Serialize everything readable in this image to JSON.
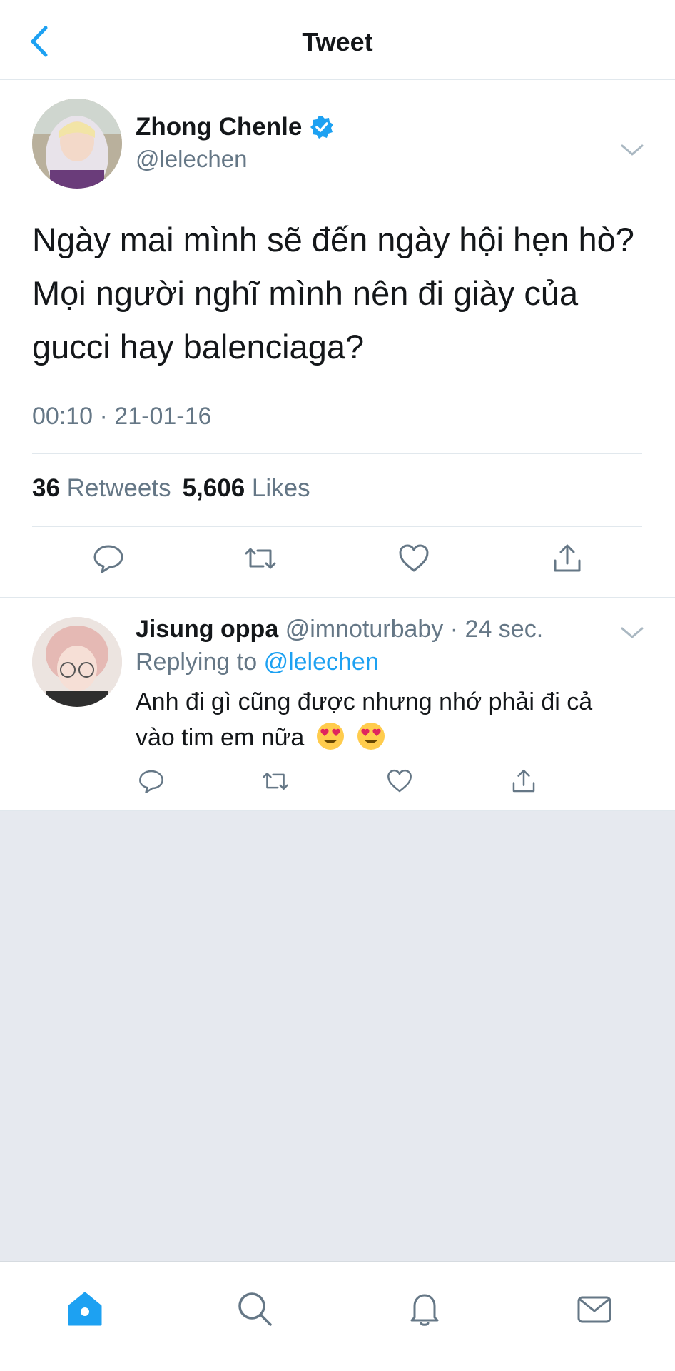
{
  "header": {
    "title": "Tweet",
    "back_icon": "chevron-left-icon"
  },
  "main_tweet": {
    "author_name": "Zhong Chenle",
    "author_handle": "@lelechen",
    "verified": true,
    "text": "Ngày mai mình sẽ đến ngày hội hẹn hò? Mọi người nghĩ mình nên đi giày của gucci hay balenciaga?",
    "timestamp": "00:10 · 21-01-16",
    "retweets_count": "36",
    "retweets_label": "Retweets",
    "likes_count": "5,606",
    "likes_label": "Likes"
  },
  "reply": {
    "author_name": "Jisung oppa",
    "author_handle": "@imnoturbaby",
    "time": "· 24 sec.",
    "replying_prefix": "Replying to",
    "replying_to": "@lelechen",
    "text": "Anh đi gì cũng được nhưng nhớ phải đi cả vào tim em nữa"
  },
  "tabbar": {
    "items": [
      "home-icon",
      "search-icon",
      "notifications-icon",
      "messages-icon"
    ],
    "active": "home-icon"
  },
  "colors": {
    "accent": "#1da1f2",
    "icon_gray": "#657786",
    "divider": "#e1e8ed",
    "empty_bg": "#e6e9ef"
  }
}
